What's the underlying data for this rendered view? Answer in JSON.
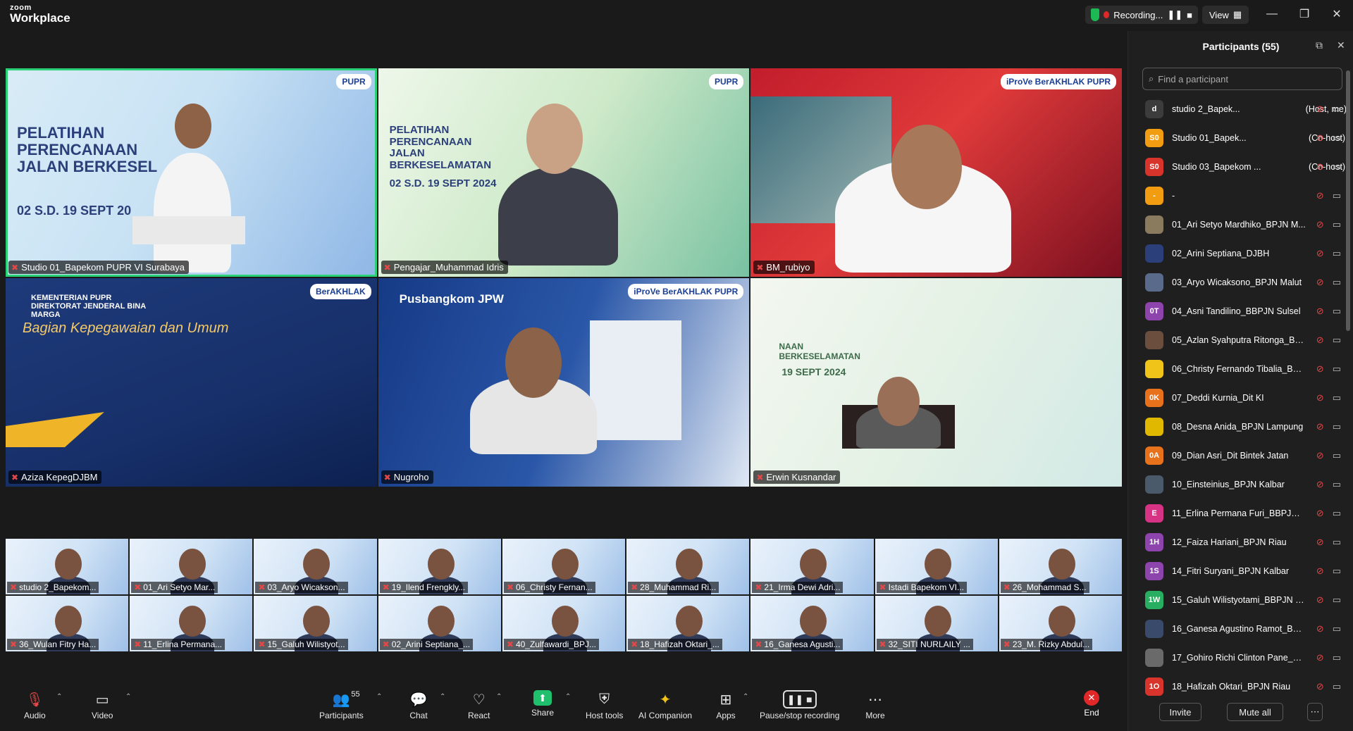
{
  "app": {
    "brand_small": "zoom",
    "brand_large": "Workplace"
  },
  "titlebar": {
    "recording_label": "Recording...",
    "view_label": "View"
  },
  "speakers": [
    {
      "name": "Studio 01_Bapekom PUPR VI Surabaya",
      "active": true,
      "slide_title": "PELATIHAN PERENCANAAN JALAN BERKESEL",
      "slide_date": "02 S.D. 19 SEPT 20",
      "logo": "PUPR"
    },
    {
      "name": "Pengajar_Muhammad Idris",
      "slide_title": "PELATIHAN PERENCANAAN JALAN BERKESELAMATAN",
      "slide_date": "02 S.D. 19 SEPT 2024",
      "logo": "PUPR"
    },
    {
      "name": "BM_rubiyo",
      "logo": "iProVe BerAKHLAK PUPR"
    },
    {
      "name": "Aziza KepegDJBM",
      "slide_title": "KEMENTERIAN PUPR DIREKTORAT JENDERAL BINA MARGA",
      "slide_sub": "Bagian Kepegawaian dan Umum",
      "logo": "BerAKHLAK"
    },
    {
      "name": "Nugroho",
      "slide_title": "Pusbangkom JPW",
      "logo": "iProVe BerAKHLAK PUPR"
    },
    {
      "name": "Erwin Kusnandar",
      "slide_title": "NAAN BERKESELAMATAN",
      "slide_date": "19 SEPT 2024"
    }
  ],
  "thumbnails": [
    {
      "name": "studio 2_Bapekom..."
    },
    {
      "name": "01_Ari Setyo Mar..."
    },
    {
      "name": "03_Aryo Wicakson..."
    },
    {
      "name": "19_Ilend Frengkly..."
    },
    {
      "name": "06_Christy Fernan..."
    },
    {
      "name": "28_Muhammad Ri..."
    },
    {
      "name": "21_Irma Dewi Adri..."
    },
    {
      "name": "Istadi Bapekom VI..."
    },
    {
      "name": "26_Mohammad S..."
    },
    {
      "name": "36_Wulan Fitry Ha..."
    },
    {
      "name": "11_Erlina Permana..."
    },
    {
      "name": "15_Galuh Wilistyot..."
    },
    {
      "name": "02_Arini Septiana_..."
    },
    {
      "name": "40_Zulfawardi_BPJ..."
    },
    {
      "name": "18_Hafizah Oktari_..."
    },
    {
      "name": "16_Ganesa Agusti..."
    },
    {
      "name": "32_SITI NURLAILY ..."
    },
    {
      "name": "23_M. Rizky Abdul..."
    }
  ],
  "toolbar": {
    "audio": "Audio",
    "video": "Video",
    "participants": "Participants",
    "participants_count": "55",
    "chat": "Chat",
    "react": "React",
    "share": "Share",
    "host_tools": "Host tools",
    "ai_companion": "AI Companion",
    "apps": "Apps",
    "pause_recording": "Pause/stop recording",
    "more": "More",
    "end": "End"
  },
  "panel": {
    "title": "Participants (55)",
    "search_placeholder": "Find a participant",
    "invite": "Invite",
    "mute_all": "Mute all",
    "participants": [
      {
        "initials": "d",
        "color": "#3c3c3c",
        "name": "studio 2_Bapek...",
        "role": "(Host, me)"
      },
      {
        "initials": "S0",
        "color": "#f29c12",
        "name": "Studio 01_Bapek...",
        "role": "(Co-host)"
      },
      {
        "initials": "S0",
        "color": "#d9342b",
        "name": "Studio 03_Bapekom ...",
        "role": "(Co-host)"
      },
      {
        "initials": "-",
        "color": "#f29c12",
        "name": "-",
        "role": ""
      },
      {
        "initials": "",
        "color": "#8a7a5e",
        "name": "01_Ari Setyo Mardhiko_BPJN M...",
        "role": ""
      },
      {
        "initials": "",
        "color": "#2b3f7a",
        "name": "02_Arini Septiana_DJBH",
        "role": ""
      },
      {
        "initials": "",
        "color": "#5a6a8a",
        "name": "03_Aryo Wicaksono_BPJN Malut",
        "role": ""
      },
      {
        "initials": "0T",
        "color": "#8e44ad",
        "name": "04_Asni Tandilino_BBPJN Sulsel",
        "role": ""
      },
      {
        "initials": "",
        "color": "#6b4e3d",
        "name": "05_Azlan Syahputra Ritonga_BP...",
        "role": ""
      },
      {
        "initials": "",
        "color": "#f0c419",
        "name": "06_Christy Fernando Tibalia_BPJ...",
        "role": ""
      },
      {
        "initials": "0K",
        "color": "#e8721c",
        "name": "07_Deddi Kurnia_Dit KI",
        "role": ""
      },
      {
        "initials": "",
        "color": "#e0b800",
        "name": "08_Desna Anida_BPJN Lampung",
        "role": ""
      },
      {
        "initials": "0A",
        "color": "#e8721c",
        "name": "09_Dian Asri_Dit Bintek Jatan",
        "role": ""
      },
      {
        "initials": "",
        "color": "#4a5a6a",
        "name": "10_Einsteinius_BPJN Kalbar",
        "role": ""
      },
      {
        "initials": "E",
        "color": "#d63384",
        "name": "11_Erlina Permana Furi_BBPJN J...",
        "role": ""
      },
      {
        "initials": "1H",
        "color": "#8e44ad",
        "name": "12_Faiza Hariani_BPJN Riau",
        "role": ""
      },
      {
        "initials": "1S",
        "color": "#8e44ad",
        "name": "14_Fitri Suryani_BPJN Kalbar",
        "role": ""
      },
      {
        "initials": "1W",
        "color": "#27ae60",
        "name": "15_Galuh Wilistyotami_BBPJN D...",
        "role": ""
      },
      {
        "initials": "",
        "color": "#3a4a6a",
        "name": "16_Ganesa Agustino Ramot_BPJ...",
        "role": ""
      },
      {
        "initials": "",
        "color": "#6a6a6a",
        "name": "17_Gohiro Richi Clinton Pane_B...",
        "role": ""
      },
      {
        "initials": "1O",
        "color": "#d9342b",
        "name": "18_Hafizah Oktari_BPJN Riau",
        "role": ""
      }
    ]
  }
}
